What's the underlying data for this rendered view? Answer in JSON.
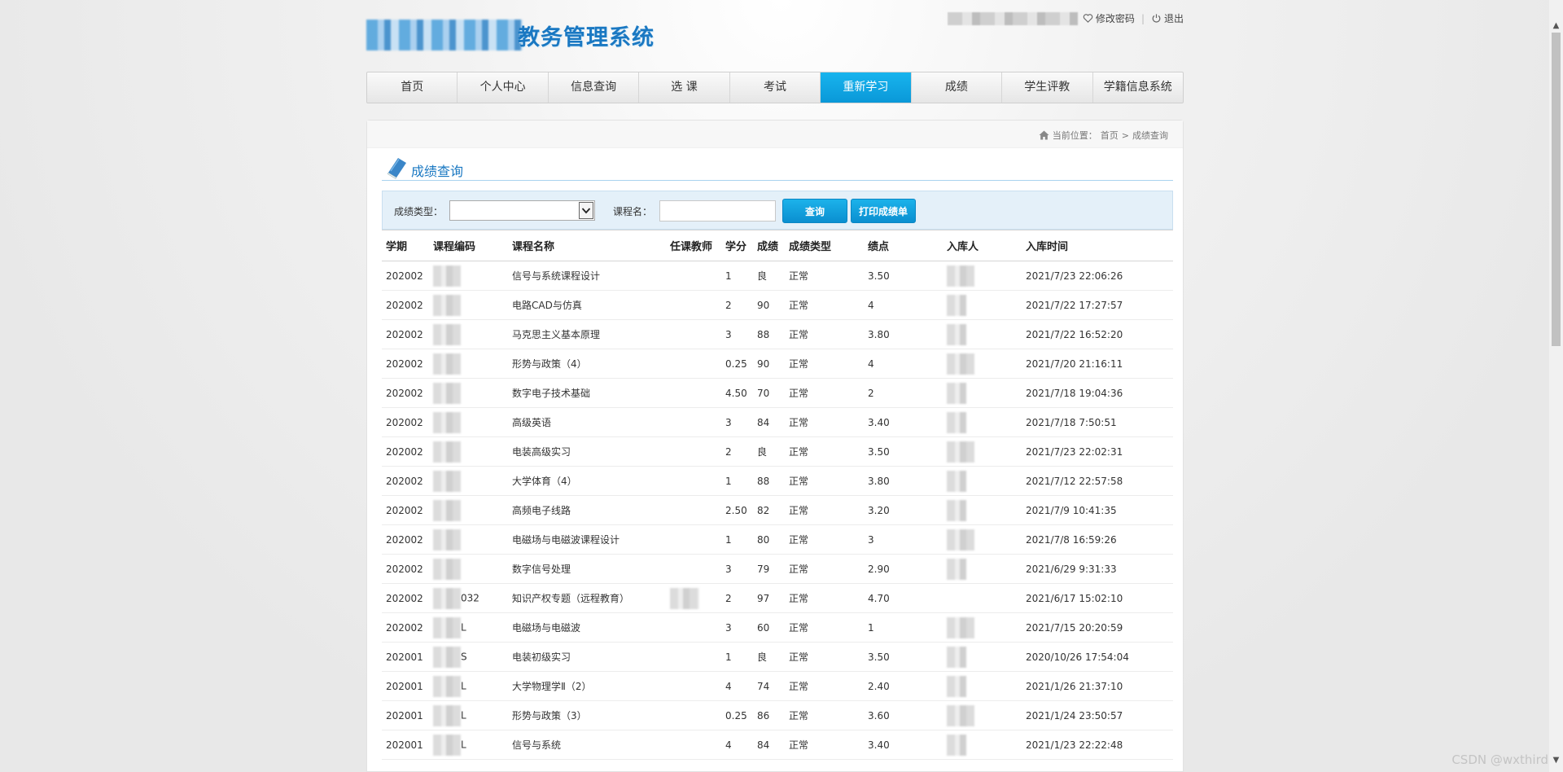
{
  "header": {
    "system_name": "教务管理系统",
    "change_password": "修改密码",
    "logout": "退出"
  },
  "nav": [
    {
      "label": "首页"
    },
    {
      "label": "个人中心"
    },
    {
      "label": "信息查询"
    },
    {
      "label": "选 课"
    },
    {
      "label": "考试"
    },
    {
      "label": "重新学习",
      "active": true
    },
    {
      "label": "成绩"
    },
    {
      "label": "学生评教"
    },
    {
      "label": "学籍信息系统"
    }
  ],
  "breadcrumb": {
    "prefix": "当前位置：",
    "home": "首页",
    "separator": ">",
    "current": "成绩查询"
  },
  "page_title": "成绩查询",
  "filter": {
    "type_label": "成绩类型：",
    "type_value": "",
    "course_label": "课程名：",
    "course_value": "",
    "query_button": "查询",
    "print_button": "打印成绩单"
  },
  "table": {
    "headers": [
      "学期",
      "课程编码",
      "课程名称",
      "任课教师",
      "学分",
      "成绩",
      "成绩类型",
      "绩点",
      "入库人",
      "入库时间"
    ],
    "rows": [
      {
        "term": "202002",
        "code": "",
        "name": "信号与系统课程设计",
        "teacher": "",
        "credit": "1",
        "score": "良",
        "type": "正常",
        "gpa": "3.50",
        "time": "2021/7/23 22:06:26"
      },
      {
        "term": "202002",
        "code": "",
        "name": "电路CAD与仿真",
        "teacher": "",
        "credit": "2",
        "score": "90",
        "type": "正常",
        "gpa": "4",
        "time": "2021/7/22 17:27:57"
      },
      {
        "term": "202002",
        "code": "",
        "name": "马克思主义基本原理",
        "teacher": "",
        "credit": "3",
        "score": "88",
        "type": "正常",
        "gpa": "3.80",
        "time": "2021/7/22 16:52:20"
      },
      {
        "term": "202002",
        "code": "",
        "name": "形势与政策（4）",
        "teacher": "",
        "credit": "0.25",
        "score": "90",
        "type": "正常",
        "gpa": "4",
        "time": "2021/7/20 21:16:11"
      },
      {
        "term": "202002",
        "code": "",
        "name": "数字电子技术基础",
        "teacher": "",
        "credit": "4.50",
        "score": "70",
        "type": "正常",
        "gpa": "2",
        "time": "2021/7/18 19:04:36"
      },
      {
        "term": "202002",
        "code": "",
        "name": "高级英语",
        "teacher": "",
        "credit": "3",
        "score": "84",
        "type": "正常",
        "gpa": "3.40",
        "time": "2021/7/18 7:50:51"
      },
      {
        "term": "202002",
        "code": "",
        "name": "电装高级实习",
        "teacher": "",
        "credit": "2",
        "score": "良",
        "type": "正常",
        "gpa": "3.50",
        "time": "2021/7/23 22:02:31"
      },
      {
        "term": "202002",
        "code": "",
        "name": "大学体育（4）",
        "teacher": "",
        "credit": "1",
        "score": "88",
        "type": "正常",
        "gpa": "3.80",
        "time": "2021/7/12 22:57:58"
      },
      {
        "term": "202002",
        "code": "",
        "name": "高频电子线路",
        "teacher": "",
        "credit": "2.50",
        "score": "82",
        "type": "正常",
        "gpa": "3.20",
        "time": "2021/7/9 10:41:35"
      },
      {
        "term": "202002",
        "code": "",
        "name": "电磁场与电磁波课程设计",
        "teacher": "",
        "credit": "1",
        "score": "80",
        "type": "正常",
        "gpa": "3",
        "time": "2021/7/8 16:59:26"
      },
      {
        "term": "202002",
        "code": "",
        "name": "数字信号处理",
        "teacher": "",
        "credit": "3",
        "score": "79",
        "type": "正常",
        "gpa": "2.90",
        "time": "2021/6/29 9:31:33"
      },
      {
        "term": "202002",
        "code": "032",
        "name": "知识产权专题（远程教育）",
        "teacher": "",
        "credit": "2",
        "score": "97",
        "type": "正常",
        "gpa": "4.70",
        "time": "2021/6/17 15:02:10"
      },
      {
        "term": "202002",
        "code": "L",
        "name": "电磁场与电磁波",
        "teacher": "",
        "credit": "3",
        "score": "60",
        "type": "正常",
        "gpa": "1",
        "time": "2021/7/15 20:20:59"
      },
      {
        "term": "202001",
        "code": "S",
        "name": "电装初级实习",
        "teacher": "",
        "credit": "1",
        "score": "良",
        "type": "正常",
        "gpa": "3.50",
        "time": "2020/10/26 17:54:04"
      },
      {
        "term": "202001",
        "code": "L",
        "name": "大学物理学Ⅱ（2）",
        "teacher": "",
        "credit": "4",
        "score": "74",
        "type": "正常",
        "gpa": "2.40",
        "time": "2021/1/26 21:37:10"
      },
      {
        "term": "202001",
        "code": "L",
        "name": "形势与政策（3）",
        "teacher": "",
        "credit": "0.25",
        "score": "86",
        "type": "正常",
        "gpa": "3.60",
        "time": "2021/1/24 23:50:57"
      },
      {
        "term": "202001",
        "code": "L",
        "name": "信号与系统",
        "teacher": "",
        "credit": "4",
        "score": "84",
        "type": "正常",
        "gpa": "3.40",
        "time": "2021/1/23 22:22:48"
      }
    ]
  },
  "watermark": "CSDN @wxthird"
}
